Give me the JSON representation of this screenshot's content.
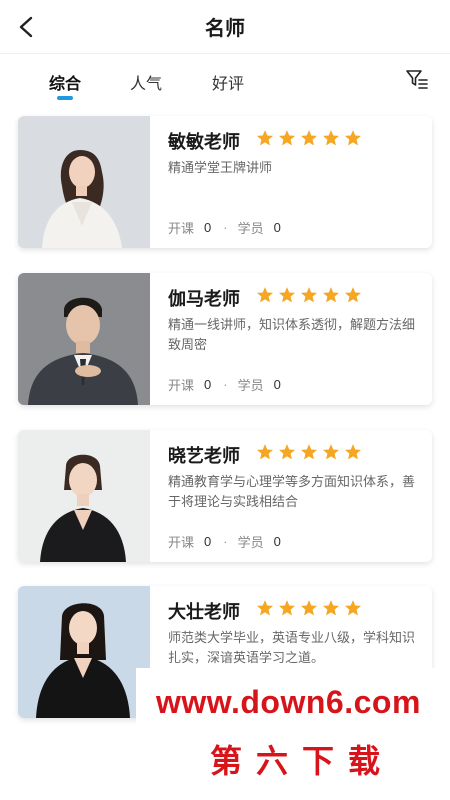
{
  "header": {
    "title": "名师",
    "back_icon": "back-chevron-icon"
  },
  "tabs": [
    {
      "label": "综合",
      "active": true
    },
    {
      "label": "人气",
      "active": false
    },
    {
      "label": "好评",
      "active": false
    }
  ],
  "filter_icon": "filter-icon",
  "colors": {
    "accent": "#1e9be0",
    "star": "#f5a623",
    "watermark": "#d8141b"
  },
  "teachers": [
    {
      "name": "敏敏老师",
      "rating": 5,
      "desc": "精通学堂王牌讲师",
      "courses_label": "开课",
      "courses": "0",
      "students_label": "学员",
      "students": "0",
      "separator": "·"
    },
    {
      "name": "伽马老师",
      "rating": 5,
      "desc": "精通一线讲师，知识体系透彻，解题方法细致周密",
      "courses_label": "开课",
      "courses": "0",
      "students_label": "学员",
      "students": "0",
      "separator": "·"
    },
    {
      "name": "晓艺老师",
      "rating": 5,
      "desc": "精通教育学与心理学等多方面知识体系，善于将理论与实践相结合",
      "courses_label": "开课",
      "courses": "0",
      "students_label": "学员",
      "students": "0",
      "separator": "·"
    },
    {
      "name": "大壮老师",
      "rating": 5,
      "desc": "师范类大学毕业，英语专业八级，学科知识扎实，深谙英语学习之道。"
    }
  ],
  "watermark": {
    "url": "www.down6.com",
    "text": "第六下载"
  }
}
